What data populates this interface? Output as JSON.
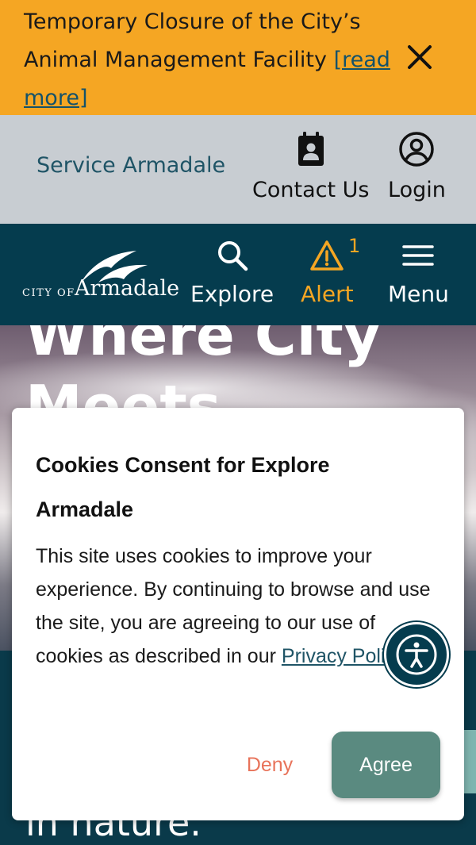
{
  "banner": {
    "text": "Temporary Closure of the City’s Animal Management Facility ",
    "link": "[read more]",
    "close_icon": "close-icon"
  },
  "utility": {
    "service_link": "Service Armadale",
    "contact_label": "Contact Us",
    "login_label": "Login"
  },
  "nav": {
    "logo_small": "CITY OF",
    "logo_big": "Armadale",
    "explore_label": "Explore",
    "alert_label": "Alert",
    "alert_count": "1",
    "menu_label": "Menu"
  },
  "hero": {
    "line1": "Where City",
    "line2": "Meets",
    "tagline": "in nature."
  },
  "cookie": {
    "title": "Cookies Consent for Explore Armadale",
    "body": "This site uses cookies to improve your experience. By continuing to browse and use the site, you are agreeing to our use of cookies as described in our ",
    "link": "Privacy Policy",
    "body_end": ".",
    "deny_label": "Deny",
    "agree_label": "Agree"
  },
  "colors": {
    "banner_bg": "#f5a623",
    "nav_bg": "#053c4e",
    "util_bg": "#c8cdd2",
    "agree_bg": "#5a8a80",
    "deny_text": "#e8735a"
  }
}
